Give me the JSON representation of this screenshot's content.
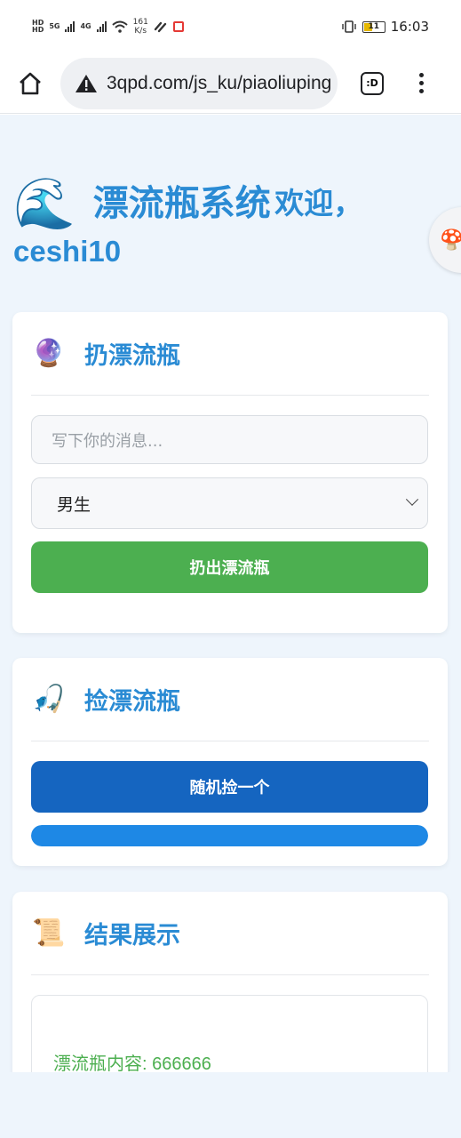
{
  "status_bar": {
    "hd1": "HD",
    "hd2": "HD",
    "net1": "5G",
    "net2": "4G",
    "speed_value": "161",
    "speed_unit": "K/s",
    "battery_level": "11",
    "time": "16:03"
  },
  "browser": {
    "url": "3qpd.com/js_ku/piaoliuping",
    "tab_label": ":D"
  },
  "header": {
    "wave_emoji": "🌊",
    "title": "漂流瓶系统",
    "welcome": "欢迎，",
    "username": "ceshi10"
  },
  "throw_card": {
    "emoji": "🔮",
    "title": "扔漂流瓶",
    "message_placeholder": "写下你的消息...",
    "gender_selected": "男生",
    "throw_button": "扔出漂流瓶"
  },
  "pick_card": {
    "emoji": "🎣",
    "title": "捡漂流瓶",
    "pick_button": "随机捡一个",
    "progress": 1.0
  },
  "result_card": {
    "emoji": "📜",
    "title": "结果展示",
    "content_text": "漂流瓶内容: 666666"
  },
  "colors": {
    "accent": "#2a8bd4",
    "green_button": "#4caf50",
    "blue_button": "#1565c0",
    "progress": "#1e88e5",
    "page_bg": "#eef5fc"
  }
}
